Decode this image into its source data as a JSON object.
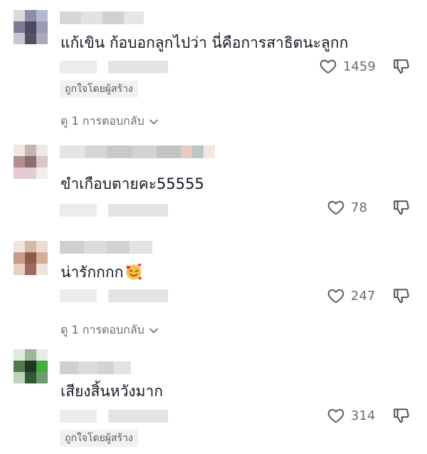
{
  "comments": [
    {
      "text": "แก้เขิน ก้อบอกลูกไปว่า นี่คือการสาธิตนะลูกก",
      "likes": "1459",
      "creator_badge": "ถูกใจโดยผู้สร้าง",
      "replies": "ดู 1 การตอบกลับ"
    },
    {
      "text": "ขำเกือบตายคะ55555",
      "likes": "78"
    },
    {
      "text": "น่ารักกกก",
      "emoji": "smiling-face-with-hearts",
      "likes": "247",
      "replies": "ดู 1 การตอบกลับ"
    },
    {
      "text": "เสียงสิ้นหวังมาก",
      "likes": "314",
      "creator_badge": "ถูกใจโดยผู้สร้าง"
    }
  ],
  "icons": {
    "like": "heart-outline-icon",
    "dislike": "thumbs-down-outline-icon",
    "expand": "chevron-down-icon"
  },
  "colors": {
    "text": "#161823",
    "secondary": "#6b6b6b",
    "badge_bg": "#f1f1f2"
  }
}
